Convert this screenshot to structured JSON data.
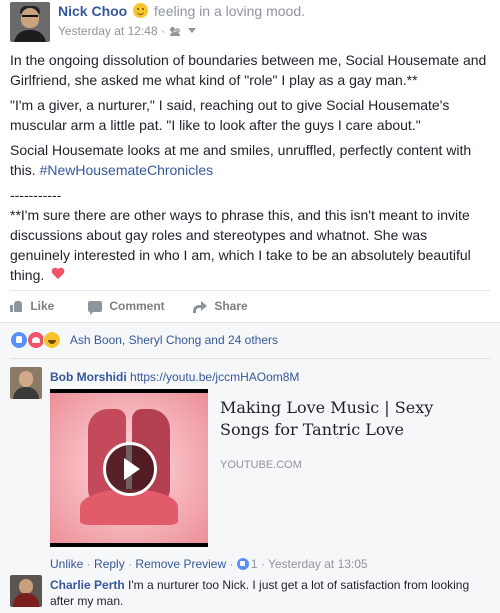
{
  "post": {
    "author": "Nick Choo",
    "feeling": "feeling in a loving mood.",
    "emoji": "smile-emoji",
    "timestamp": "Yesterday at 12:48",
    "meta_sep": "·",
    "privacy": "friends-icon",
    "paragraphs": {
      "p1": "In the ongoing dissolution of boundaries between me, Social Housemate and Girlfriend, she asked me what kind of \"role\" I play as a gay man.**",
      "p2": "\"I'm a giver, a nurturer,\" I said, reaching out to give Social Housemate's muscular arm a little pat. \"I like to look after the guys I care about.\"",
      "p3_text": "Social Housemate looks at me and smiles, unruffled, perfectly content with this.",
      "p3_hashtag": "#NewHousemateChronicles",
      "divider": "-----------",
      "p4": "**I'm sure there are other ways to phrase this, and this isn't meant to invite discussions about gay roles and stereotypes and whatnot. She was genuinely interested in who I am, which I take to be an absolutely beautiful thing."
    }
  },
  "actions": {
    "like": "Like",
    "comment": "Comment",
    "share": "Share"
  },
  "reactions": {
    "icons": [
      "like-icon",
      "love-icon",
      "haha-icon"
    ],
    "text": "Ash Boon, Sheryl Chong and 24 others"
  },
  "comments": [
    {
      "author": "Bob Morshidi",
      "text": "https://youtu.be/jccmHAOom8M",
      "preview": {
        "title": "Making Love Music | Sexy Songs for Tantric Love",
        "domain": "YOUTUBE.COM"
      },
      "meta": {
        "unlike": "Unlike",
        "reply": "Reply",
        "remove_preview": "Remove Preview",
        "likes": "1",
        "time": "Yesterday at 13:05",
        "sep": "·"
      }
    },
    {
      "author": "Charlie Perth",
      "text": "I'm a nurturer too Nick. I just get a lot of satisfaction from looking after my man."
    }
  ],
  "colors": {
    "link": "#365899",
    "muted": "#90949c",
    "heart": "#f25268",
    "like_blue": "#5890ff"
  }
}
